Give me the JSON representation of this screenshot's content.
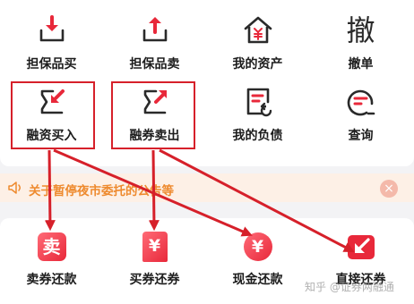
{
  "grid": {
    "row1": [
      {
        "label": "担保品买",
        "icon": "download-tray-icon"
      },
      {
        "label": "担保品卖",
        "icon": "upload-tray-icon"
      },
      {
        "label": "我的资产",
        "icon": "home-yen-icon"
      },
      {
        "label": "撤单",
        "icon": "cancel-order-char-icon",
        "glyph": "撤"
      }
    ],
    "row2": [
      {
        "label": "融资买入",
        "icon": "margin-buy-arrow-icon"
      },
      {
        "label": "融券卖出",
        "icon": "short-sell-arrow-icon"
      },
      {
        "label": "我的负债",
        "icon": "liability-doc-icon"
      },
      {
        "label": "查询",
        "icon": "query-search-icon"
      }
    ]
  },
  "notice": {
    "text": "关于暂停夜市委托的公告等",
    "close_symbol": "×"
  },
  "repay": {
    "items": [
      {
        "label": "卖券还款",
        "icon": "sell-repay-icon",
        "glyph": "卖"
      },
      {
        "label": "买券还券",
        "icon": "buy-return-icon",
        "glyph": "¥"
      },
      {
        "label": "现金还款",
        "icon": "cash-repay-icon",
        "glyph": "¥"
      },
      {
        "label": "直接还券",
        "icon": "direct-return-icon"
      }
    ]
  },
  "watermark": "知乎 @证券两融通",
  "colors": {
    "accent": "#e8283a",
    "highlight_border": "#d6202a",
    "notice_text": "#ee8a2e",
    "notice_bg": "#fdf0e6",
    "icon_dark": "#2a2a2a"
  }
}
